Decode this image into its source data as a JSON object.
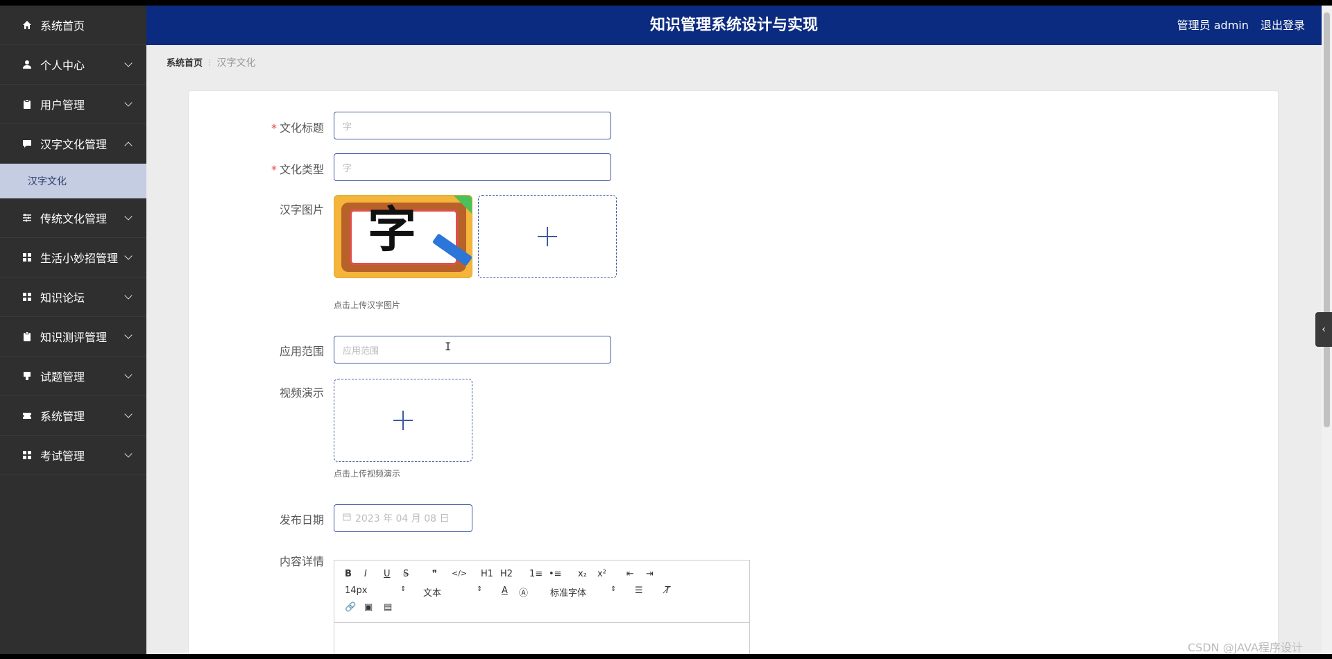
{
  "header": {
    "title": "知识管理系统设计与实现",
    "user": "管理员 admin",
    "logout": "退出登录"
  },
  "sidebar": {
    "items": [
      {
        "label": "系统首页",
        "icon": "home-icon"
      },
      {
        "label": "个人中心",
        "icon": "user-icon"
      },
      {
        "label": "用户管理",
        "icon": "clipboard-icon"
      },
      {
        "label": "汉字文化管理",
        "icon": "chat-icon"
      },
      {
        "label": "传统文化管理",
        "icon": "sliders-icon"
      },
      {
        "label": "生活小妙招管理",
        "icon": "grid-icon"
      },
      {
        "label": "知识论坛",
        "icon": "grid-icon"
      },
      {
        "label": "知识测评管理",
        "icon": "clipboard-icon"
      },
      {
        "label": "试题管理",
        "icon": "stamp-icon"
      },
      {
        "label": "系统管理",
        "icon": "ticket-icon"
      },
      {
        "label": "考试管理",
        "icon": "grid-icon"
      }
    ],
    "subitem": "汉字文化"
  },
  "breadcrumb": {
    "home": "系统首页",
    "current": "汉字文化"
  },
  "form": {
    "title_label": "文化标题",
    "title_value": "字",
    "type_label": "文化类型",
    "type_value": "字",
    "image_label": "汉字图片",
    "image_glyph": "字",
    "image_hint": "点击上传汉字图片",
    "scope_label": "应用范围",
    "scope_placeholder": "应用范围",
    "video_label": "视频演示",
    "video_hint": "点击上传视频演示",
    "date_label": "发布日期",
    "date_value": "2023 年 04 月 08 日",
    "content_label": "内容详情"
  },
  "editor": {
    "font_size": "14px",
    "header_select": "文本",
    "font_family": "标准字体",
    "buttons": [
      "B",
      "I",
      "U",
      "S",
      "❞",
      "</>",
      "H1",
      "H2",
      "1≡",
      "•≡",
      "x₂",
      "x²",
      "⇤",
      "⇥"
    ]
  },
  "watermark": "CSDN @JAVA程序设计"
}
